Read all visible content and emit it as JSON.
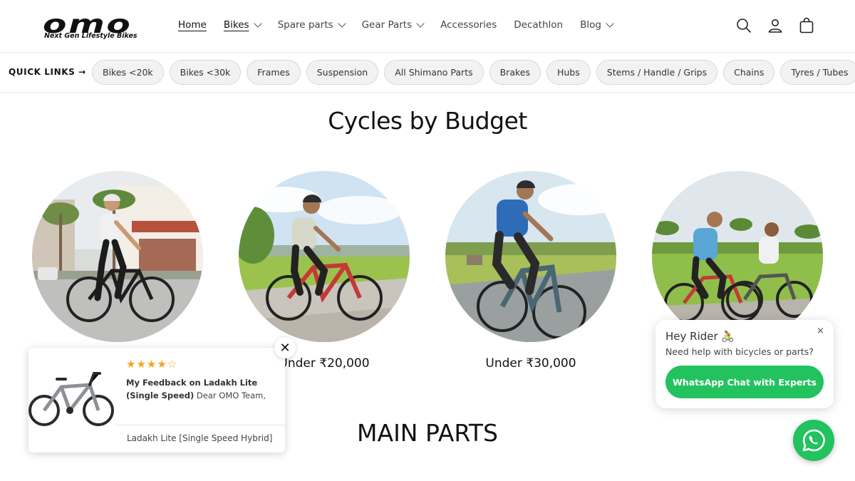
{
  "brand": {
    "logo_text": "omo",
    "tagline": "Next Gen Lifestyle Bikes"
  },
  "nav": [
    {
      "label": "Home",
      "active": true,
      "has_dropdown": false
    },
    {
      "label": "Bikes",
      "active": true,
      "has_dropdown": true
    },
    {
      "label": "Spare parts",
      "active": false,
      "has_dropdown": true
    },
    {
      "label": "Gear Parts",
      "active": false,
      "has_dropdown": true
    },
    {
      "label": "Accessories",
      "active": false,
      "has_dropdown": false
    },
    {
      "label": "Decathlon",
      "active": false,
      "has_dropdown": false
    },
    {
      "label": "Blog",
      "active": false,
      "has_dropdown": true
    }
  ],
  "header_icons": [
    "search-icon",
    "account-icon",
    "cart-icon"
  ],
  "quick_links": {
    "title": "QUICK LINKS →",
    "items": [
      "Bikes <20k",
      "Bikes <30k",
      "Frames",
      "Suspension",
      "All Shimano Parts",
      "Brakes",
      "Hubs",
      "Stems / Handle / Grips",
      "Chains",
      "Tyres / Tubes"
    ]
  },
  "budget": {
    "title": "Cycles by Budget",
    "items": [
      {
        "label": ""
      },
      {
        "label": "Under ₹20,000"
      },
      {
        "label": "Under ₹30,000"
      },
      {
        "label": ""
      }
    ]
  },
  "main_parts": {
    "title": "MAIN PARTS"
  },
  "review_popup": {
    "stars": "★★★★☆",
    "rating": 4,
    "title": "My Feedback on Ladakh Lite (Single Speed)",
    "body": "Dear OMO Team, My experience with Ladakh Lite...",
    "product": "Ladakh Lite [Single Speed Hybrid]",
    "close": "✕"
  },
  "whatsapp": {
    "greeting": "Hey Rider 🚴",
    "help": "Need help with bicycles or parts?",
    "button": "WhatsApp Chat with Experts",
    "close": "×"
  },
  "colors": {
    "accent_green": "#22c25f",
    "star": "#f6a21a",
    "pill_bg": "#f2f2f2",
    "text": "#121212"
  }
}
